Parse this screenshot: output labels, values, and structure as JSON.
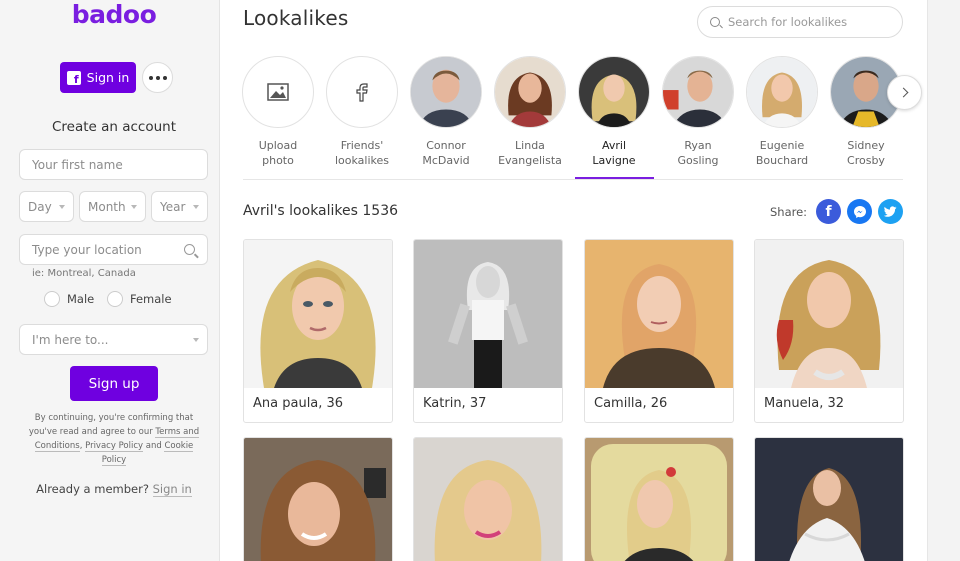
{
  "app": {
    "logo": "badoo"
  },
  "sidebar": {
    "signin_label": "Sign in",
    "create_title": "Create an account",
    "first_name_placeholder": "Your first name",
    "day": "Day",
    "month": "Month",
    "year": "Year",
    "location_placeholder": "Type your location",
    "location_hint": "ie: Montreal, Canada",
    "gender_male": "Male",
    "gender_female": "Female",
    "here_to": "I'm here to...",
    "signup_label": "Sign up",
    "legal": {
      "line1": "By continuing, you're confirming that",
      "line2_a": "you've read and agree to our ",
      "terms_a": "Terms and",
      "terms_b": "Conditions",
      "comma": ", ",
      "privacy": "Privacy Policy",
      "and": " and ",
      "cookie_a": "Cookie",
      "cookie_b": "Policy"
    },
    "already": "Already a member?",
    "signin_link": "Sign in"
  },
  "main": {
    "title": "Lookalikes",
    "search_placeholder": "Search for lookalikes",
    "celebs": [
      {
        "label": "Upload\nphoto",
        "icon": "image-icon"
      },
      {
        "label": "Friends'\nlookalikes",
        "icon": "facebook-icon"
      },
      {
        "label": "Connor\nMcDavid"
      },
      {
        "label": "Linda\nEvangelista"
      },
      {
        "label": "Avril\nLavigne",
        "active": true
      },
      {
        "label": "Ryan\nGosling"
      },
      {
        "label": "Eugenie\nBouchard"
      },
      {
        "label": "Sidney\nCrosby"
      }
    ],
    "results_title": "Avril's lookalikes 1536",
    "share_label": "Share:",
    "results": [
      {
        "name": "Ana paula, 36"
      },
      {
        "name": "Katrin, 37"
      },
      {
        "name": "Camilla, 26"
      },
      {
        "name": "Manuela, 32"
      }
    ]
  },
  "colors": {
    "brand": "#6f00e0",
    "facebook": "#3b5bdb",
    "messenger": "#1877f2",
    "twitter": "#1da1f2"
  }
}
